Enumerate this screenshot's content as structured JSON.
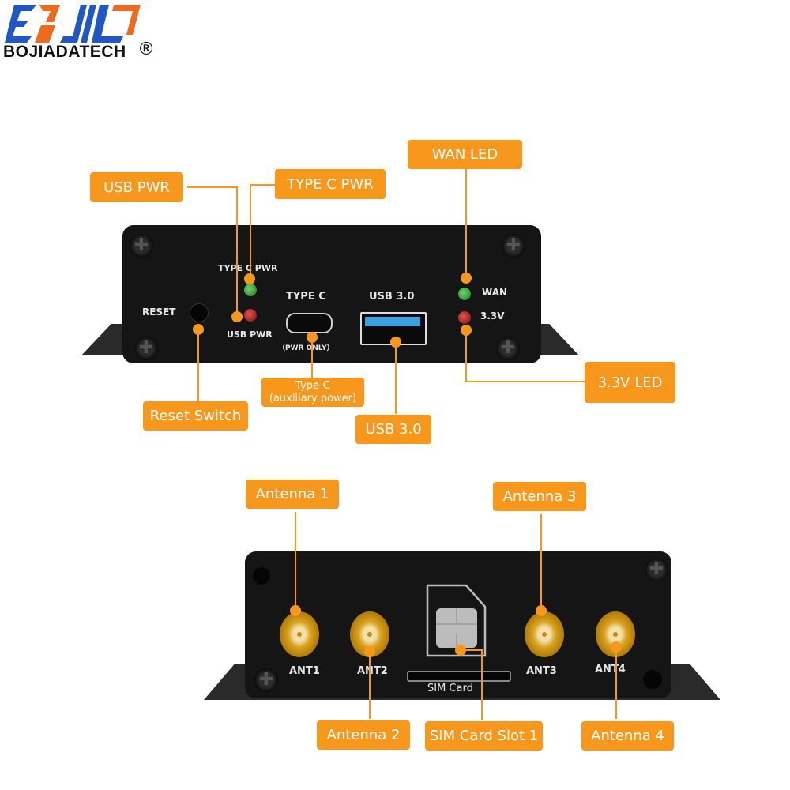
{
  "brand": {
    "name": "BOJIADATECH",
    "registered_mark": "®",
    "logo_colors": {
      "blue": "#2157c5",
      "orange": "#ef6a1c"
    }
  },
  "accent_color": "#f7981d",
  "front_panel": {
    "printed_labels": {
      "type_c_pwr_led": "TYPE C PWR",
      "usb_pwr_led": "USB PWR",
      "reset": "RESET",
      "type_c": "TYPE C",
      "pwr_only": "（PWR ONLY）",
      "usb30": "USB 3.0",
      "wan": "WAN",
      "v33": "3.3V"
    },
    "callouts": {
      "usb_pwr": "USB PWR",
      "type_c_pwr": "TYPE C PWR",
      "wan_led": "WAN LED",
      "v33_led": "3.3V LED",
      "reset_switch": "Reset Switch",
      "type_c_line1": "Type-C",
      "type_c_line2": "(auxiliary power)",
      "usb30": "USB 3.0"
    }
  },
  "rear_panel": {
    "printed_labels": {
      "ant1": "ANT1",
      "ant2": "ANT2",
      "ant3": "ANT3",
      "ant4": "ANT4",
      "sim_card": "SIM  Card"
    },
    "callouts": {
      "antenna1": "Antenna 1",
      "antenna2": "Antenna 2",
      "antenna3": "Antenna 3",
      "antenna4": "Antenna 4",
      "sim_slot": "SIM Card Slot 1"
    }
  }
}
